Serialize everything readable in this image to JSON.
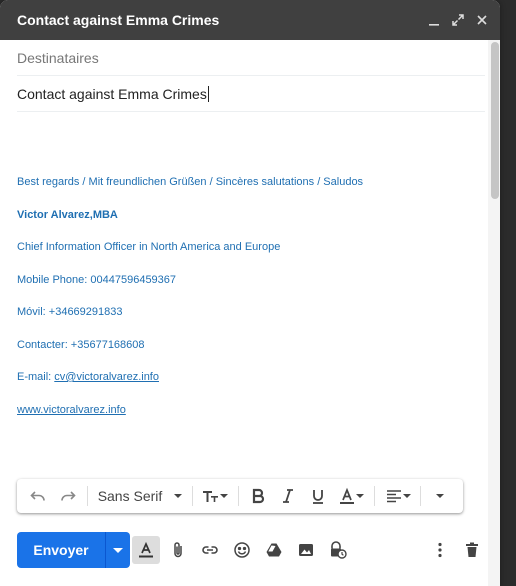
{
  "window": {
    "title": "Contact against Emma Crimes"
  },
  "recipients": {
    "placeholder": "Destinataires"
  },
  "subject": {
    "value": "Contact against Emma Crimes"
  },
  "signature": {
    "greeting": "Best regards / Mit freundlichen Grüßen / Sincères salutations / Saludos",
    "name": "Victor Alvarez,MBA",
    "position": "Chief Information Officer in North America and Europe",
    "mobile": "Mobile Phone: 00447596459367",
    "movil": "Móvil: +34669291833",
    "contacter": "Contacter: +35677168608",
    "email_label": "E-mail: ",
    "email": "cv@victoralvarez.info",
    "website": "www.victoralvarez.info"
  },
  "format_toolbar": {
    "font": "Sans Serif"
  },
  "actions": {
    "send_label": "Envoyer"
  },
  "colors": {
    "titlebar": "#404040",
    "send": "#1a73e8",
    "signature": "#1f6fb2"
  }
}
